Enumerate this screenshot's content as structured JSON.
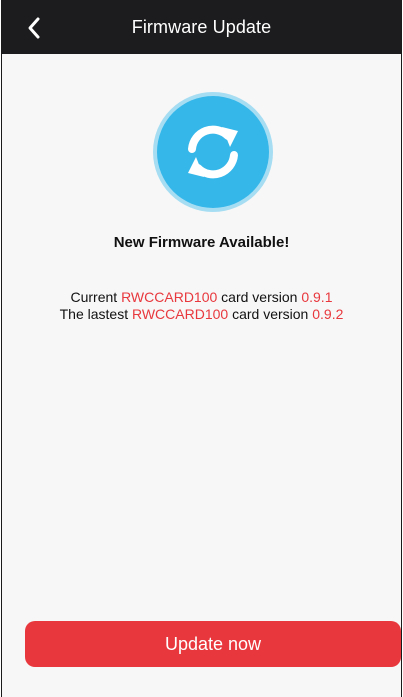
{
  "header": {
    "title": "Firmware Update",
    "back_icon": "chevron-left-icon"
  },
  "main": {
    "icon": "sync-icon",
    "headline": "New Firmware Available!",
    "current": {
      "prefix": "Current ",
      "device": "RWCCARD100",
      "middle": " card version ",
      "version": "0.9.1"
    },
    "latest": {
      "prefix": "The lastest ",
      "device": "RWCCARD100",
      "middle": " card version ",
      "version": "0.9.2"
    }
  },
  "action": {
    "update_label": "Update now"
  },
  "colors": {
    "accent_red": "#e8383d",
    "icon_blue": "#35b7ea",
    "icon_ring": "#a6ddf3",
    "nav_bg": "#1c1c1e"
  }
}
